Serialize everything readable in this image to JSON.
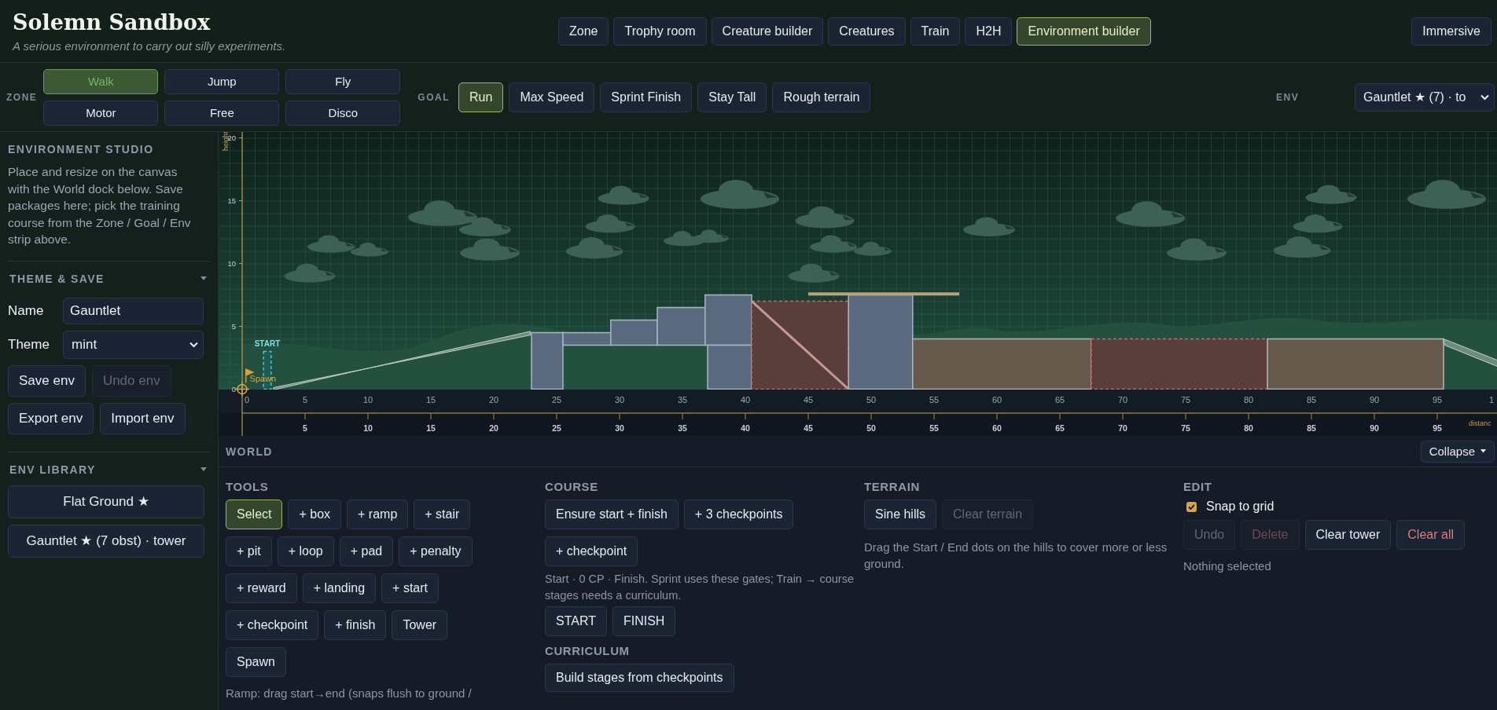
{
  "app": {
    "title": "Solemn Sandbox",
    "subtitle": "A serious environment to carry out silly experiments."
  },
  "nav": {
    "tabs": [
      {
        "label": "Zone",
        "selected": false
      },
      {
        "label": "Trophy room",
        "selected": false
      },
      {
        "label": "Creature builder",
        "selected": false
      },
      {
        "label": "Creatures",
        "selected": false
      },
      {
        "label": "Train",
        "selected": false
      },
      {
        "label": "H2H",
        "selected": false
      },
      {
        "label": "Environment builder",
        "selected": true
      }
    ],
    "immersive": "Immersive"
  },
  "zone": {
    "label": "ZONE",
    "options": [
      {
        "label": "Walk",
        "selected": true
      },
      {
        "label": "Jump",
        "selected": false
      },
      {
        "label": "Fly",
        "selected": false
      },
      {
        "label": "Motor",
        "selected": false
      },
      {
        "label": "Free",
        "selected": false
      },
      {
        "label": "Disco",
        "selected": false
      }
    ]
  },
  "goal": {
    "label": "GOAL",
    "options": [
      {
        "label": "Run",
        "selected": true
      },
      {
        "label": "Max Speed",
        "selected": false
      },
      {
        "label": "Sprint Finish",
        "selected": false
      },
      {
        "label": "Stay Tall",
        "selected": false
      },
      {
        "label": "Rough terrain",
        "selected": false
      }
    ]
  },
  "env": {
    "label": "ENV",
    "value": "Gauntlet ★ (7) · to"
  },
  "sidebar": {
    "title": "ENVIRONMENT STUDIO",
    "description": "Place and resize on the canvas with the World dock below. Save packages here; pick the training course from the Zone / Goal / Env strip above.",
    "theme_save": {
      "title": "THEME & SAVE",
      "expanded": true,
      "name_label": "Name",
      "name_value": "Gauntlet",
      "theme_label": "Theme",
      "theme_value": "mint",
      "buttons": [
        {
          "label": "Save env",
          "disabled": false
        },
        {
          "label": "Undo env",
          "disabled": true
        },
        {
          "label": "Export env",
          "disabled": false
        },
        {
          "label": "Import env",
          "disabled": false
        }
      ]
    },
    "library": {
      "title": "ENV LIBRARY",
      "expanded": true,
      "items": [
        "Flat Ground ★",
        "Gauntlet ★ (7 obst) · tower"
      ]
    }
  },
  "canvas": {
    "y_axis_label": "height",
    "y_ticks": [
      "20",
      "15",
      "10",
      "5",
      "0"
    ],
    "x_ticks": [
      "0",
      "5",
      "10",
      "15",
      "20",
      "25",
      "30",
      "35",
      "40",
      "45",
      "50",
      "55",
      "60",
      "65",
      "70",
      "75",
      "80",
      "85",
      "90",
      "95",
      "1"
    ],
    "ruler_ticks": [
      "5",
      "10",
      "15",
      "20",
      "25",
      "30",
      "35",
      "40",
      "45",
      "50",
      "55",
      "60",
      "65",
      "70",
      "75",
      "80",
      "85",
      "90",
      "95"
    ],
    "x_axis_label": "distanc",
    "start_label": "START",
    "spawn_label": "Spawn"
  },
  "dock": {
    "title": "WORLD",
    "collapse": "Collapse",
    "tools": {
      "title": "TOOLS",
      "buttons": [
        {
          "label": "Select",
          "selected": true
        },
        {
          "label": "+ box",
          "selected": false
        },
        {
          "label": "+ ramp",
          "selected": false
        },
        {
          "label": "+ stair",
          "selected": false
        },
        {
          "label": "+ pit",
          "selected": false
        },
        {
          "label": "+ loop",
          "selected": false
        },
        {
          "label": "+ pad",
          "selected": false
        },
        {
          "label": "+ penalty",
          "selected": false
        },
        {
          "label": "+ reward",
          "selected": false
        },
        {
          "label": "+ landing",
          "selected": false
        },
        {
          "label": "+ start",
          "selected": false
        },
        {
          "label": "+ checkpoint",
          "selected": false
        },
        {
          "label": "+ finish",
          "selected": false
        },
        {
          "label": "Tower",
          "selected": false
        },
        {
          "label": "Spawn",
          "selected": false
        }
      ],
      "hint": "Ramp: drag start→end (snaps flush to ground /"
    },
    "course": {
      "title": "COURSE",
      "buttons": [
        "Ensure start + finish",
        "+ 3 checkpoints",
        "+ checkpoint"
      ],
      "note": "Start · 0 CP · Finish. Sprint uses these gates; Train → course stages needs a curriculum.",
      "gates": [
        "START",
        "FINISH"
      ],
      "curriculum_title": "CURRICULUM",
      "curriculum_button": "Build stages from checkpoints"
    },
    "terrain": {
      "title": "TERRAIN",
      "buttons": [
        {
          "label": "Sine hills",
          "disabled": false
        },
        {
          "label": "Clear terrain",
          "disabled": true
        }
      ],
      "note": "Drag the Start / End dots on the hills to cover more or less ground."
    },
    "edit": {
      "title": "EDIT",
      "snap": {
        "label": "Snap to grid",
        "checked": true
      },
      "buttons": [
        {
          "label": "Undo",
          "kind": "normal",
          "disabled": true
        },
        {
          "label": "Delete",
          "kind": "danger",
          "disabled": true
        },
        {
          "label": "Clear tower",
          "kind": "normal",
          "disabled": false
        },
        {
          "label": "Clear all",
          "kind": "danger",
          "disabled": false
        }
      ],
      "status": "Nothing selected"
    }
  }
}
